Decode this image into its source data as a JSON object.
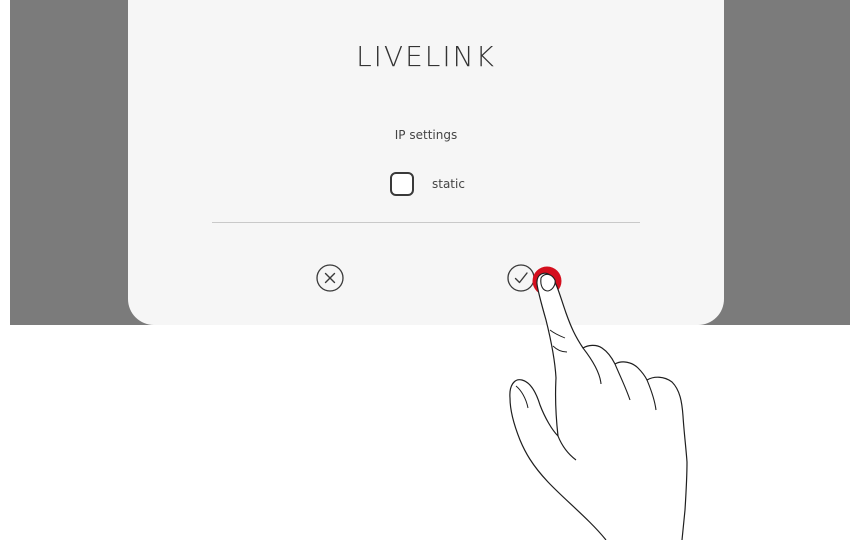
{
  "dialog": {
    "title": "LIVELINK",
    "section_label": "IP settings",
    "static_option": {
      "label": "static",
      "checked": false
    },
    "cancel_icon": "close-circle-icon",
    "confirm_icon": "check-circle-icon"
  },
  "colors": {
    "backdrop": "#7b7b7b",
    "dialog_background": "#f6f6f6",
    "touch_indicator": "#d40f1e"
  }
}
